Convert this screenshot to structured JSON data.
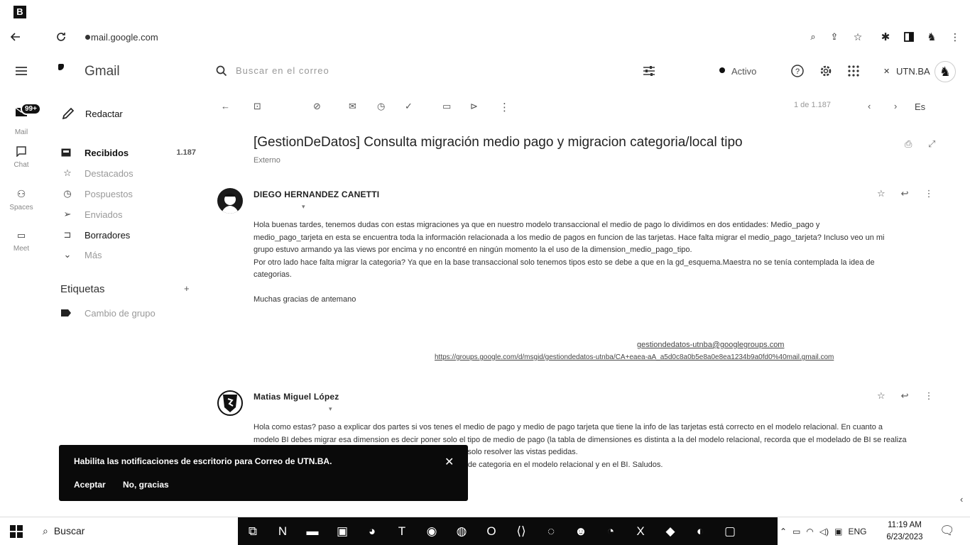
{
  "browser": {
    "logo_letter": "B",
    "url": "mail.google.com",
    "nav_icons": [
      "back-arrow-icon",
      "reload-icon",
      "site-info-icon"
    ],
    "toolbar_icons": [
      "search-icon",
      "share-icon",
      "bookmark-star-icon",
      "extensions-icon",
      "sidebar-icon",
      "profile-icon",
      "kebab-menu-icon"
    ]
  },
  "header": {
    "app_name": "Gmail",
    "search_placeholder": "Buscar en el correo",
    "status": "Activo",
    "account": "UTN.BA"
  },
  "rail": [
    {
      "label": "Mail",
      "icon": "mail-icon",
      "badge": "99+"
    },
    {
      "label": "Chat",
      "icon": "chat-icon",
      "badge": ""
    },
    {
      "label": "Spaces",
      "icon": "spaces-icon",
      "badge": ""
    },
    {
      "label": "Meet",
      "icon": "meet-icon",
      "badge": ""
    }
  ],
  "nav": {
    "compose": "Redactar",
    "items": [
      {
        "label": "Recibidos",
        "count": "1.187",
        "icon": "inbox-icon"
      },
      {
        "label": "Destacados",
        "count": "",
        "icon": "star-icon"
      },
      {
        "label": "Pospuestos",
        "count": "",
        "icon": "clock-icon"
      },
      {
        "label": "Enviados",
        "count": "",
        "icon": "send-icon"
      },
      {
        "label": "Borradores",
        "count": "",
        "icon": "draft-icon"
      },
      {
        "label": "Más",
        "count": "",
        "icon": "chevron-down-icon"
      }
    ],
    "labels_title": "Etiquetas",
    "labels_add": "+",
    "labels": [
      {
        "label": "Cambio de grupo",
        "icon": "label-icon"
      }
    ]
  },
  "toolbar": {
    "pager": "1 de 1.187",
    "language": "Es"
  },
  "thread": {
    "subject": "[GestionDeDatos] Consulta migración medio pago y migracion categoria/local tipo",
    "tag": "Externo",
    "messages": [
      {
        "sender": "DIEGO HERNANDEZ CANETTI",
        "body": [
          "Hola buenas tardes, tenemos dudas con estas migraciones ya que en nuestro modelo transaccional el medio de pago lo dividimos en dos entidades: Medio_pago y",
          "medio_pago_tarjeta en esta se encuentra toda la información relacionada a los medio de pagos en funcion de las tarjetas. Hace falta migrar el medio_pago_tarjeta? Incluso veo un mi",
          "grupo estuvo armando ya las views por encima y no encontré en ningún momento la el uso de la dimension_medio_pago_tipo.",
          "Por otro lado hace falta migrar la categoria? Ya que en la base transaccional solo tenemos tipos esto se debe a que en la gd_esquema.Maestra no se tenía contemplada la idea de",
          "categorias.",
          "",
          "Muchas gracias de antemano"
        ],
        "footer_lines": [
          "gestiondedatos-utnba@googlegroups.com",
          "https://groups.google.com/d/msgid/gestiondedatos-utnba/CA+eaea-aA_a5d0c8a0b5e8a0e8ea1234b9a0fd0%40mail.gmail.com"
        ]
      },
      {
        "sender": "Matias Miguel López",
        "body": [
          "Hola como estas? paso a explicar dos partes si vos tenes el medio de pago y medio de pago tarjeta que tiene la info de las tarjetas está correcto en el modelo relacional. En cuanto a",
          "modelo BI debes migrar esa dimension es decir poner solo el tipo de medio de pago (la tabla de dimensiones es distinta a la del modelo relacional, recorda que el modelado de BI se realiza",
          "para que el usuario lo lea y lo resuelve en forma sencilla y no solo resolver las vistas pedidas.",
          "Y lo mismo aplica a categoria tenes que hacer los 3 ejemplos de categoria en el modelo relacional y en el BI. Saludos."
        ]
      }
    ]
  },
  "snackbar": {
    "message": "Habilita las notificaciones de escritorio para Correo de UTN.BA.",
    "accept": "Aceptar",
    "decline": "No, gracias"
  },
  "taskbar": {
    "search": "Buscar",
    "language": "ENG",
    "time": "11:19 AM",
    "date": "6/23/2023"
  }
}
